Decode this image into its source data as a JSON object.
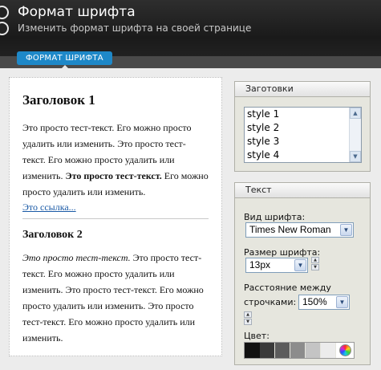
{
  "header": {
    "title": "Формат шрифта",
    "subtitle": "Изменить формат шрифта на своей странице",
    "tab_label": "ФОРМАТ ШРИФТА",
    "controls": [
      "circle-button",
      "circle-button"
    ]
  },
  "preview": {
    "heading1": "Заголовок 1",
    "para1_a": "Это просто тест-текст. Его можно просто удалить или изменить. Это просто тест-текст. Его можно просто удалить или изменить. ",
    "para1_bold": "Это просто тест-текст.",
    "para1_b": " Его можно просто удалить или изменить.",
    "link": "Это ссылка...",
    "heading2": "Заголовок 2",
    "para2_italic": "Это просто тест-текст.",
    "para2_rest": " Это просто тест-текст. Его можно просто удалить или изменить. Это просто тест-текст. Его можно просто удалить или изменить. Это просто тест-текст. Его можно просто удалить или изменить."
  },
  "presets": {
    "title": "Заготовки",
    "items": [
      "style 1",
      "style 2",
      "style 3",
      "style 4"
    ]
  },
  "text_panel": {
    "title": "Текст",
    "font_label": "Вид шрифта:",
    "font_value": "Times New Roman",
    "size_label": "Размер шрифта:",
    "size_value": "13px",
    "spacing_label_1": "Расстояние между",
    "spacing_label_2": "строчками:",
    "spacing_value": "150%",
    "color_label": "Цвет:",
    "swatches": [
      "#111111",
      "#3a3a3a",
      "#5c5c5c",
      "#8c8c8c",
      "#c4c4c4",
      "#ececec"
    ],
    "selected_swatch": 0
  },
  "colors": {
    "tab": "#1e88c8",
    "link": "#1a5aa6",
    "header_bg": "#1f1f1f"
  }
}
